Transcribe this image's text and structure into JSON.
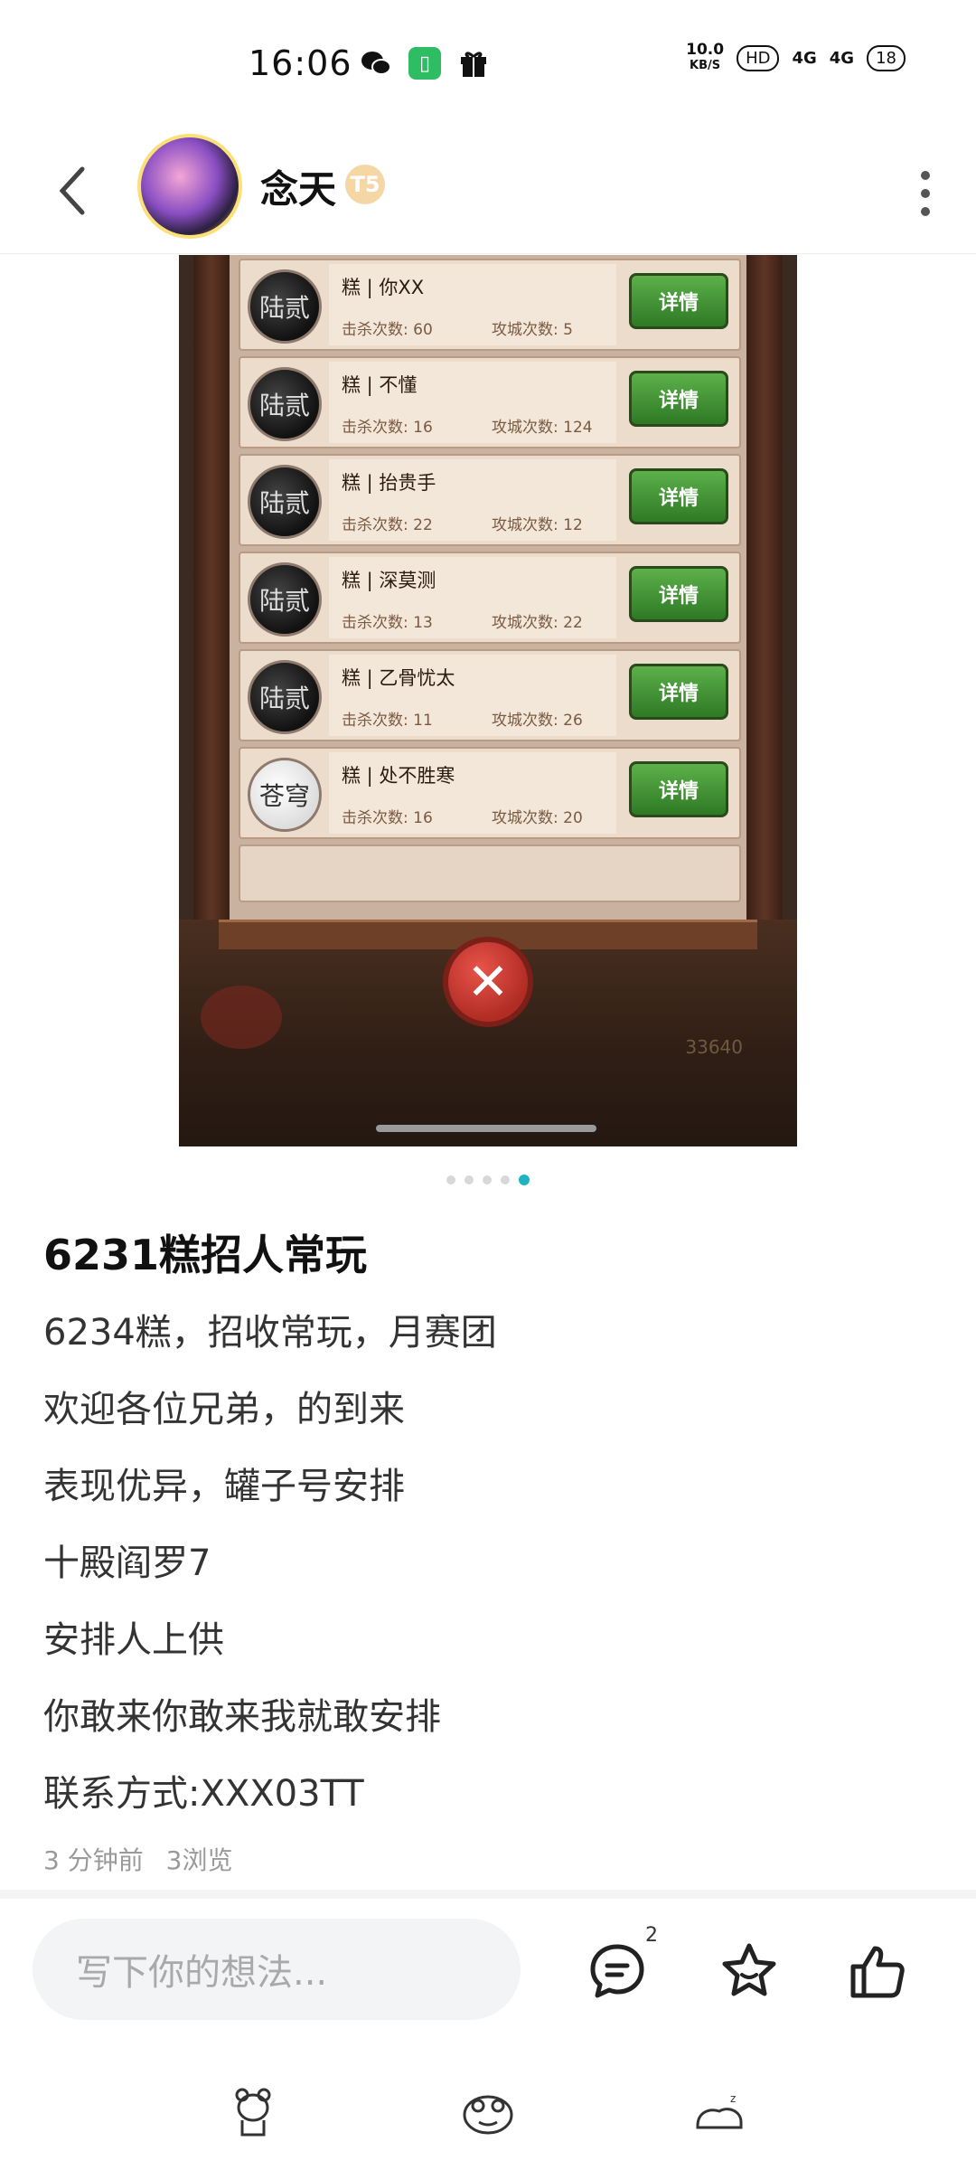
{
  "status_bar": {
    "time": "16:06",
    "net_speed_value": "10.0",
    "net_speed_unit": "KB/S",
    "hd_label": "HD",
    "net1": "4G",
    "net2": "4G",
    "battery": "18",
    "icons": [
      "wechat-icon",
      "sim-icon",
      "gift-icon"
    ]
  },
  "header": {
    "username": "念天",
    "badge": "T5"
  },
  "image_content": {
    "rows": [
      {
        "icon_text": "陆贰",
        "name": "糕 | 你XX",
        "kills": "击杀次数: 60",
        "sieges": "攻城次数: 5",
        "button": "详情"
      },
      {
        "icon_text": "陆贰",
        "name": "糕 | 不懂",
        "kills": "击杀次数: 16",
        "sieges": "攻城次数: 124",
        "button": "详情"
      },
      {
        "icon_text": "陆贰",
        "name": "糕 | 抬贵手",
        "kills": "击杀次数: 22",
        "sieges": "攻城次数: 12",
        "button": "详情"
      },
      {
        "icon_text": "陆贰",
        "name": "糕 | 深莫测",
        "kills": "击杀次数: 13",
        "sieges": "攻城次数: 22",
        "button": "详情"
      },
      {
        "icon_text": "陆贰",
        "name": "糕 | 乙骨忧太",
        "kills": "击杀次数: 11",
        "sieges": "攻城次数: 26",
        "button": "详情"
      },
      {
        "icon_text": "苍穹",
        "name": "糕 | 处不胜寒",
        "kills": "击杀次数: 16",
        "sieges": "攻城次数: 20",
        "button": "详情"
      }
    ],
    "coins": "33640"
  },
  "pager": {
    "count": 5,
    "active": 5
  },
  "post": {
    "title": "6231糕招人常玩",
    "lines": [
      "6234糕，招收常玩，月赛团",
      "欢迎各位兄弟，的到来",
      "表现优异，罐子号安排",
      "十殿阎罗7",
      "安排人上供",
      "你敢来你敢来我就敢安排",
      "联系方式:XXX03TT"
    ],
    "time_ago": "3 分钟前",
    "views": "3浏览"
  },
  "bottom_bar": {
    "input_placeholder": "写下你的想法...",
    "comment_count": "2"
  }
}
